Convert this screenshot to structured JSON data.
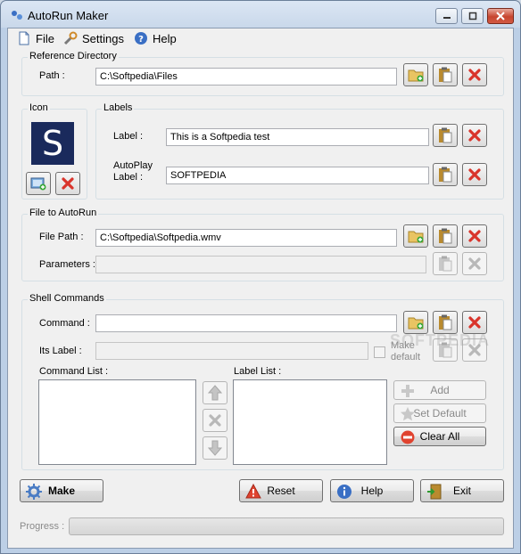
{
  "window": {
    "title": "AutoRun Maker"
  },
  "menu": {
    "file": "File",
    "settings": "Settings",
    "help": "Help"
  },
  "reference": {
    "group": "Reference Directory",
    "path_label": "Path :",
    "path_value": "C:\\Softpedia\\Files"
  },
  "icon_group": {
    "group": "Icon",
    "glyph": "S"
  },
  "labels": {
    "group": "Labels",
    "label_label": "Label :",
    "label_value": "This is a Softpedia test",
    "autoplay_label_line1": "AutoPlay",
    "autoplay_label_line2": "Label :",
    "autoplay_value": "SOFTPEDIA"
  },
  "file_autorun": {
    "group": "File to AutoRun",
    "filepath_label": "File Path :",
    "filepath_value": "C:\\Softpedia\\Softpedia.wmv",
    "parameters_label": "Parameters :",
    "parameters_value": ""
  },
  "shell": {
    "group": "Shell Commands",
    "command_label": "Command :",
    "command_value": "",
    "its_label_label": "Its Label :",
    "its_label_value": "",
    "make_default_line1": "Make",
    "make_default_line2": "default",
    "command_list_label": "Command List :",
    "label_list_label": "Label List :",
    "add": "Add",
    "set_default": "Set Default",
    "clear_all": "Clear All"
  },
  "actions": {
    "make": "Make",
    "reset": "Reset",
    "help": "Help",
    "exit": "Exit"
  },
  "progress": {
    "label": "Progress :",
    "value": 0
  },
  "watermark": "SOFTPEDIA",
  "colors": {
    "icon_bg": "#1a2a5c",
    "delete_red": "#d9342b",
    "folder": "#e9c462",
    "paste": "#b98a2e"
  }
}
